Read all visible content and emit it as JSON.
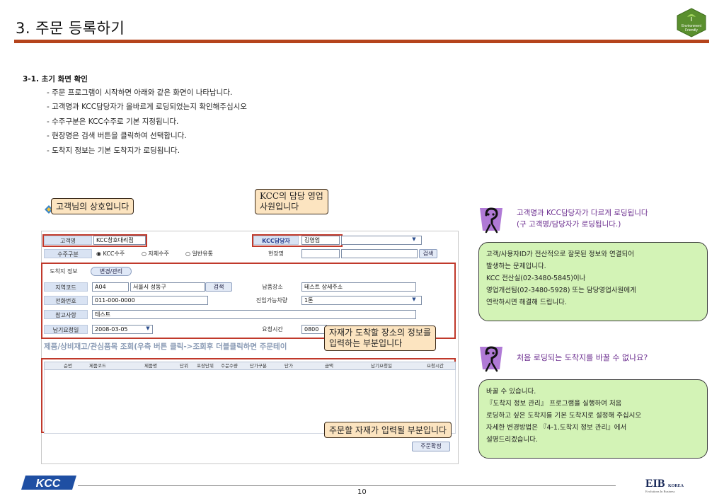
{
  "page": {
    "title": "3. 주문 등록하기",
    "page_number": "10"
  },
  "logos": {
    "eco_text_1": "Environment",
    "eco_text_2": "Friendly",
    "kcc": "KCC",
    "eib": "EIB",
    "eib_korea": "KOREA",
    "eib_tagline": "Evolutions In Business"
  },
  "intro": {
    "heading": "3-1. 초기 화면 확인",
    "bullets": [
      "- 주문 프로그램이 시작하면 아래와 같은 화면이 나타납니다.",
      "- 고객명과 KCC담당자가 올바르게 로딩되었는지 확인해주십시오",
      "- 수주구분은 KCC수주로 기본 지정됩니다.",
      "- 현장명은 검색 버튼을 클릭하여 선택합니다.",
      "- 도착지 정보는 기본 도착지가 로딩됩니다."
    ]
  },
  "form": {
    "customer_label": "고객명",
    "customer_value": "KCC창호대리점",
    "manager_label": "KCC담당자",
    "manager_value": "김영업",
    "order_type_label": "수주구분",
    "order_type_options": [
      "KCC수주",
      "자체수주",
      "일반유통"
    ],
    "site_label": "현장명",
    "search_label": "검색",
    "dest_info_label": "도착지 정보",
    "change_manage_label": "변경/관리",
    "region_code_label": "지역코드",
    "region_code_value": "A04",
    "region_name_value": "서울시 성동구",
    "delivery_place_label": "납품장소",
    "delivery_place_value": "테스트 상세주소",
    "phone_label": "전화번호",
    "phone_value": "011-000-0000",
    "vehicle_label": "진입가능차량",
    "vehicle_value": "1톤",
    "reference_label": "참고사항",
    "reference_value": "테스트",
    "due_date_label": "납기요청일",
    "due_date_value": "2008-03-05",
    "request_time_label": "요청시간",
    "request_time_value": "0800",
    "product_section_title": "제품/상비재고/관심품목 조회(우측 버튼 클릭->조회후 더블클릭하면 주문테이",
    "grid_columns": [
      "순번",
      "제품코드",
      "제품명",
      "단위",
      "포장단위",
      "주문수량",
      "단가구분",
      "단가",
      "금액",
      "납기요청일",
      "요청시간"
    ],
    "confirm_label": "주문확정"
  },
  "callouts": {
    "customer": "고객님의 상호입니다",
    "manager_line1": "KCC의 담당 영업",
    "manager_line2": "사원입니다",
    "destination_line1": "자재가 도착할 장소의 정보를",
    "destination_line2": "입력하는 부분입니다",
    "order_items": "주문할 자재가 입력될 부분입니다"
  },
  "faq": [
    {
      "question_line1": "고객명과 KCC담당자가 다르게 로딩됩니다",
      "question_line2": "(구 고객명/담당자가 로딩됩니다.)",
      "answer": [
        "고객/사용자ID가 전산적으로 잘못된 정보와 연결되어",
        "발생하는 문제입니다.",
        "KCC 전산실(02-3480-5845)이나",
        "영업개선팀(02-3480-5928) 또는 담당영업사원에게",
        "연락하시면 해결해 드립니다."
      ]
    },
    {
      "question_line1": "처음 로딩되는 도착지를 바꿀 수 없나요?",
      "answer": [
        "바꿀 수 있습니다.",
        "『도착지 정보 관리』 프로그램을 실행하여 처음",
        "로딩하고 싶은 도착지를 기본 도착지로 설정해 주십시오",
        "자세한 변경방법은 『4-1.도착지 정보 관리』에서",
        "설명드리겠습니다."
      ]
    }
  ],
  "colors": {
    "title_bar": "#b5441c",
    "callout_bg": "#fce4c0",
    "faq_bg": "#d3f3b6",
    "faq_heading": "#6b2d8f",
    "highlight_red": "#c0392b"
  }
}
